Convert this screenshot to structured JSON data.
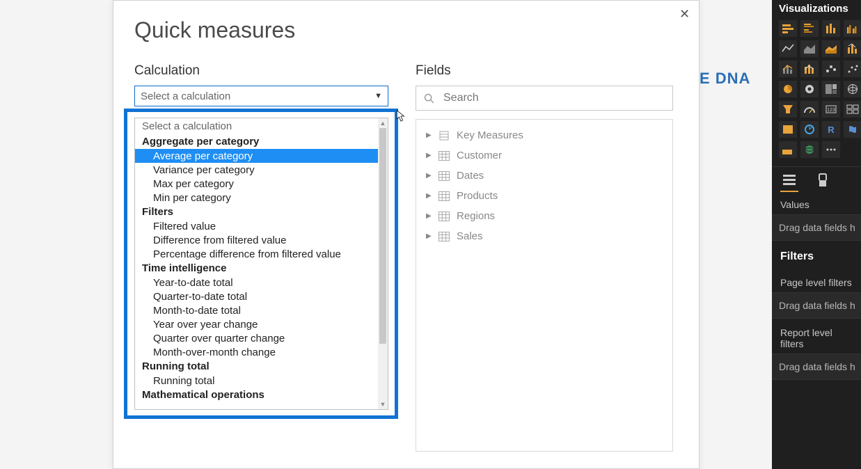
{
  "watermark": {
    "tail": "E DNA"
  },
  "dialog": {
    "title": "Quick measures",
    "close_aria": "Close",
    "calculation": {
      "label": "Calculation",
      "selected": "Select a calculation",
      "placeholder_option": "Select a calculation",
      "groups": [
        {
          "name": "Aggregate per category",
          "items": [
            {
              "label": "Average per category",
              "selected": true
            },
            {
              "label": "Variance per category"
            },
            {
              "label": "Max per category"
            },
            {
              "label": "Min per category"
            }
          ]
        },
        {
          "name": "Filters",
          "items": [
            {
              "label": "Filtered value"
            },
            {
              "label": "Difference from filtered value"
            },
            {
              "label": "Percentage difference from filtered value"
            }
          ]
        },
        {
          "name": "Time intelligence",
          "items": [
            {
              "label": "Year-to-date total"
            },
            {
              "label": "Quarter-to-date total"
            },
            {
              "label": "Month-to-date total"
            },
            {
              "label": "Year over year change"
            },
            {
              "label": "Quarter over quarter change"
            },
            {
              "label": "Month-over-month change"
            }
          ]
        },
        {
          "name": "Running total",
          "items": [
            {
              "label": "Running total"
            }
          ]
        },
        {
          "name": "Mathematical operations",
          "items": []
        }
      ]
    },
    "fields": {
      "label": "Fields",
      "search_placeholder": "Search",
      "tables": [
        {
          "label": "Key Measures",
          "icon": "measure"
        },
        {
          "label": "Customer",
          "icon": "table"
        },
        {
          "label": "Dates",
          "icon": "table"
        },
        {
          "label": "Products",
          "icon": "table"
        },
        {
          "label": "Regions",
          "icon": "table"
        },
        {
          "label": "Sales",
          "icon": "table"
        }
      ]
    }
  },
  "viz": {
    "title": "Visualizations",
    "icons": [
      "stacked-bar",
      "clustered-bar",
      "stacked-col",
      "clustered-col",
      "line",
      "area",
      "stacked-area",
      "ribbon",
      "combo-line-col",
      "combo-line-stack",
      "waterfall",
      "scatter",
      "pie",
      "donut",
      "treemap",
      "map",
      "funnel",
      "gauge",
      "card",
      "multi-card",
      "kpi",
      "slicer",
      "r-visual",
      "py-visual",
      "table",
      "matrix",
      "more"
    ],
    "values_label": "Values",
    "drag_placeholder": "Drag data fields h",
    "filters_label": "Filters",
    "page_filters_label": "Page level filters",
    "report_filters_label": "Report level filters"
  }
}
